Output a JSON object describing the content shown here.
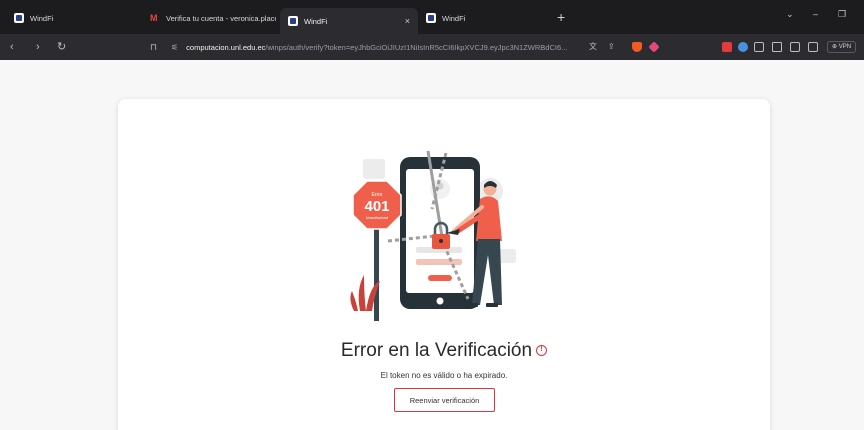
{
  "browser": {
    "tabs": [
      {
        "title": "WindFi",
        "icon": "windfi-icon"
      },
      {
        "title": "Verifica tu cuenta - veronica.placenc",
        "icon": "gmail-icon"
      },
      {
        "title": "WindFi",
        "icon": "windfi-icon",
        "active": true
      },
      {
        "title": "WindFi",
        "icon": "windfi-icon"
      }
    ],
    "tab_close": "×",
    "new_tab": "+",
    "url_host": "computacion.unl.edu.ec",
    "url_path": "/winps/auth/verify?token=eyJhbGciOiJIUzI1NiIsInR5cCI6IkpXVCJ9.eyJpc3N1ZWRBdCI6...",
    "vpn_label": "VPN",
    "colors": {
      "titlebar": "#1c1c1f",
      "toolbar": "#2c2c30",
      "accent_red": "#d9363e"
    }
  },
  "page": {
    "illustration": {
      "sign_top": "Error",
      "sign_code": "401",
      "sign_bottom": "Unauthorized"
    },
    "title": "Error en la Verificación",
    "title_icon": "alert-circle-icon",
    "message": "El token no es válido o ha expirado.",
    "resend_button": "Reenviar verificación"
  }
}
